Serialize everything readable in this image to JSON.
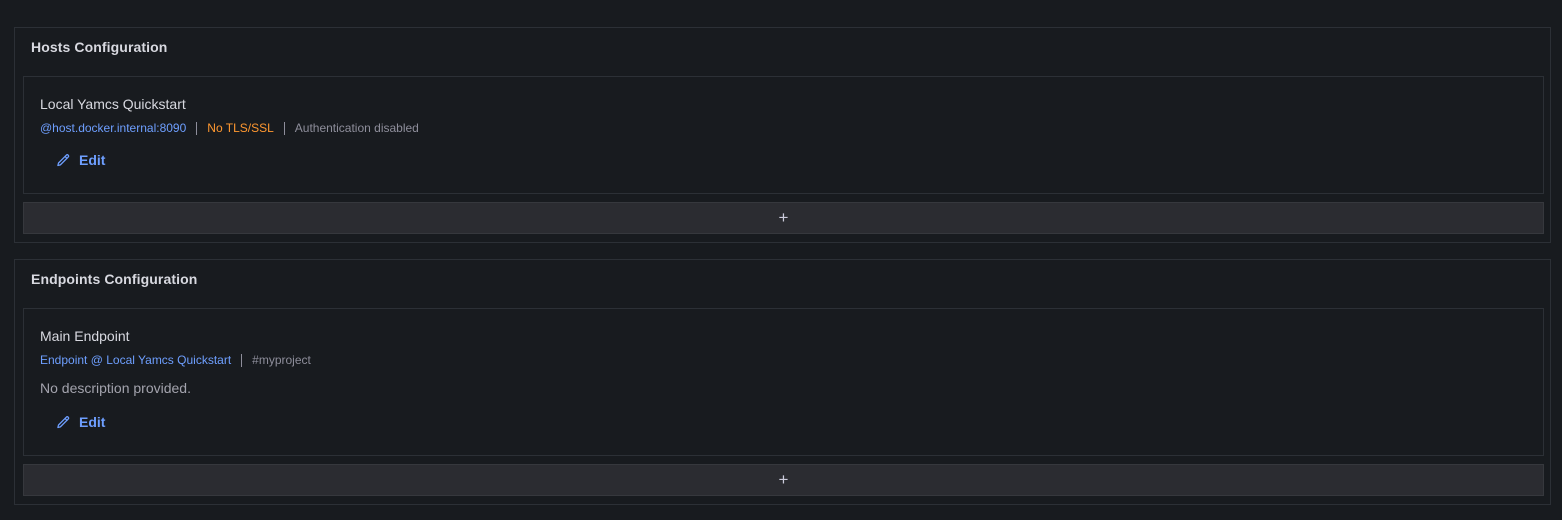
{
  "hosts": {
    "title": "Hosts Configuration",
    "item": {
      "name": "Local Yamcs Quickstart",
      "address": "@host.docker.internal:8090",
      "tls": "No TLS/SSL",
      "auth": "Authentication disabled",
      "edit_label": "Edit"
    },
    "add_label": "+"
  },
  "endpoints": {
    "title": "Endpoints Configuration",
    "item": {
      "name": "Main Endpoint",
      "host_ref": "Endpoint @ Local Yamcs Quickstart",
      "project": "#myproject",
      "description": "No description provided.",
      "edit_label": "Edit"
    },
    "add_label": "+"
  },
  "colors": {
    "background": "#181b1f",
    "link": "#6e9fff",
    "warning": "#ff9830",
    "muted": "#8e8e9b"
  },
  "icons": {
    "edit": "pencil-icon",
    "add": "plus-icon"
  }
}
